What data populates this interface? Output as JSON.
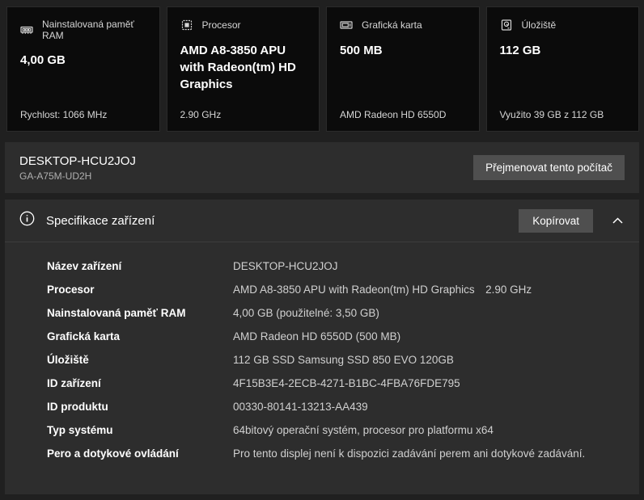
{
  "colors": {
    "page_background": "#202020",
    "card_background": "#0b0b0b",
    "panel_background": "#2d2d2d",
    "button_background": "#4f4f4f",
    "primary_text": "#ffffff",
    "secondary_text": "#d0d0d0"
  },
  "cards": [
    {
      "icon": "ram-icon",
      "title": "Nainstalovaná paměť RAM",
      "value": "4,00 GB",
      "footer": "Rychlost: 1066 MHz"
    },
    {
      "icon": "cpu-icon",
      "title": "Procesor",
      "value": "AMD A8-3850 APU with Radeon(tm) HD Graphics",
      "footer": "2.90 GHz"
    },
    {
      "icon": "gpu-icon",
      "title": "Grafická karta",
      "value": "500 MB",
      "footer": "AMD Radeon HD 6550D"
    },
    {
      "icon": "storage-icon",
      "title": "Úložiště",
      "value": "112 GB",
      "footer": "Využito 39 GB z 112 GB"
    }
  ],
  "device": {
    "name": "DESKTOP-HCU2JOJ",
    "model": "GA-A75M-UD2H",
    "rename_button_label": "Přejmenovat tento počítač"
  },
  "spec_section": {
    "title": "Specifikace zařízení",
    "copy_button_label": "Kopírovat",
    "rows": [
      {
        "label": "Název zařízení",
        "value": "DESKTOP-HCU2JOJ"
      },
      {
        "label": "Procesor",
        "value": "AMD A8-3850 APU with Radeon(tm) HD Graphics 2.90 GHz"
      },
      {
        "label": "Nainstalovaná paměť RAM",
        "value": "4,00 GB (použitelné: 3,50 GB)"
      },
      {
        "label": "Grafická karta",
        "value": "AMD Radeon HD 6550D (500 MB)"
      },
      {
        "label": "Úložiště",
        "value": "112 GB SSD Samsung SSD 850 EVO 120GB"
      },
      {
        "label": "ID zařízení",
        "value": "4F15B3E4-2ECB-4271-B1BC-4FBA76FDE795"
      },
      {
        "label": "ID produktu",
        "value": "00330-80141-13213-AA439"
      },
      {
        "label": "Typ systému",
        "value": "64bitový operační systém, procesor pro platformu x64"
      },
      {
        "label": "Pero a dotykové ovládání",
        "value": "Pro tento displej není k dispozici zadávání perem ani dotykové zadávání."
      }
    ]
  }
}
